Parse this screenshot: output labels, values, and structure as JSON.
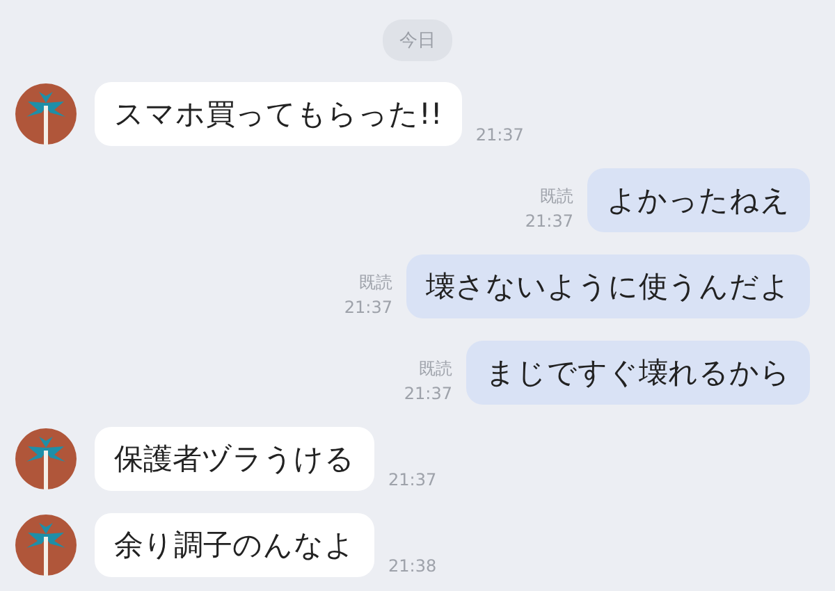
{
  "date_label": "今日",
  "messages": [
    {
      "kind": "incoming",
      "text": "スマホ買ってもらった!!",
      "time": "21:37"
    },
    {
      "kind": "outgoing",
      "text": "よかったねえ",
      "time": "21:37",
      "read": "既読"
    },
    {
      "kind": "outgoing",
      "text": "壊さないように使うんだよ",
      "time": "21:37",
      "read": "既読"
    },
    {
      "kind": "outgoing",
      "text": "まじですぐ壊れるから",
      "time": "21:37",
      "read": "既読"
    },
    {
      "kind": "incoming",
      "text": "保護者ヅラうける",
      "time": "21:37"
    },
    {
      "kind": "incoming",
      "text": "余り調子のんなよ",
      "time": "21:38"
    }
  ]
}
